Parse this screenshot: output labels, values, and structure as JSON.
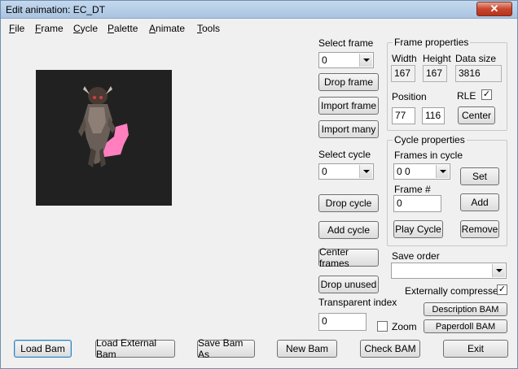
{
  "window": {
    "title": "Edit animation: EC_DT",
    "close_glyph": "✕"
  },
  "menu": [
    {
      "key": "F",
      "rest": "ile"
    },
    {
      "key": "F",
      "rest": "rame"
    },
    {
      "key": "C",
      "rest": "ycle"
    },
    {
      "key": "P",
      "rest": "alette"
    },
    {
      "key": "A",
      "rest": "nimate"
    },
    {
      "key": "T",
      "rest": "ools"
    }
  ],
  "frames": {
    "select_label": "Select frame",
    "select_value": "0",
    "drop_frame": "Drop frame",
    "import_frame": "Import frame",
    "import_many": "Import many"
  },
  "cycles": {
    "select_label": "Select cycle",
    "select_value": "0",
    "drop_cycle": "Drop cycle",
    "add_cycle": "Add cycle",
    "center_frames": "Center frames",
    "drop_unused": "Drop unused"
  },
  "transparent": {
    "label": "Transparent index",
    "value": "0"
  },
  "frame_properties": {
    "title": "Frame properties",
    "width_label": "Width",
    "width": "167",
    "height_label": "Height",
    "height": "167",
    "datasize_label": "Data size",
    "datasize": "3816",
    "position_label": "Position",
    "pos_x": "77",
    "pos_y": "116",
    "rle_label": "RLE",
    "rle_checked": true,
    "center": "Center"
  },
  "cycle_properties": {
    "title": "Cycle properties",
    "frames_in_cycle_label": "Frames in cycle",
    "frames_in_cycle_value": "0 0",
    "set": "Set",
    "frame_no_label": "Frame #",
    "frame_no_value": "0",
    "add": "Add",
    "play": "Play Cycle",
    "remove": "Remove"
  },
  "save_order": {
    "label": "Save order",
    "value": ""
  },
  "compression": {
    "label": "Externally compressed",
    "checked": true
  },
  "zoom": {
    "label": "Zoom",
    "checked": false
  },
  "description_bam": "Description BAM",
  "paperdoll_bam": "Paperdoll BAM",
  "bottom": {
    "load": "Load Bam",
    "load_external": "Load External Bam",
    "save_as": "Save Bam As",
    "new": "New Bam",
    "check": "Check BAM",
    "exit": "Exit"
  },
  "colors": {
    "preview_bg": "#212121",
    "sprite_pink": "#ff7fbf",
    "title_bg": "#b9d1ea"
  }
}
